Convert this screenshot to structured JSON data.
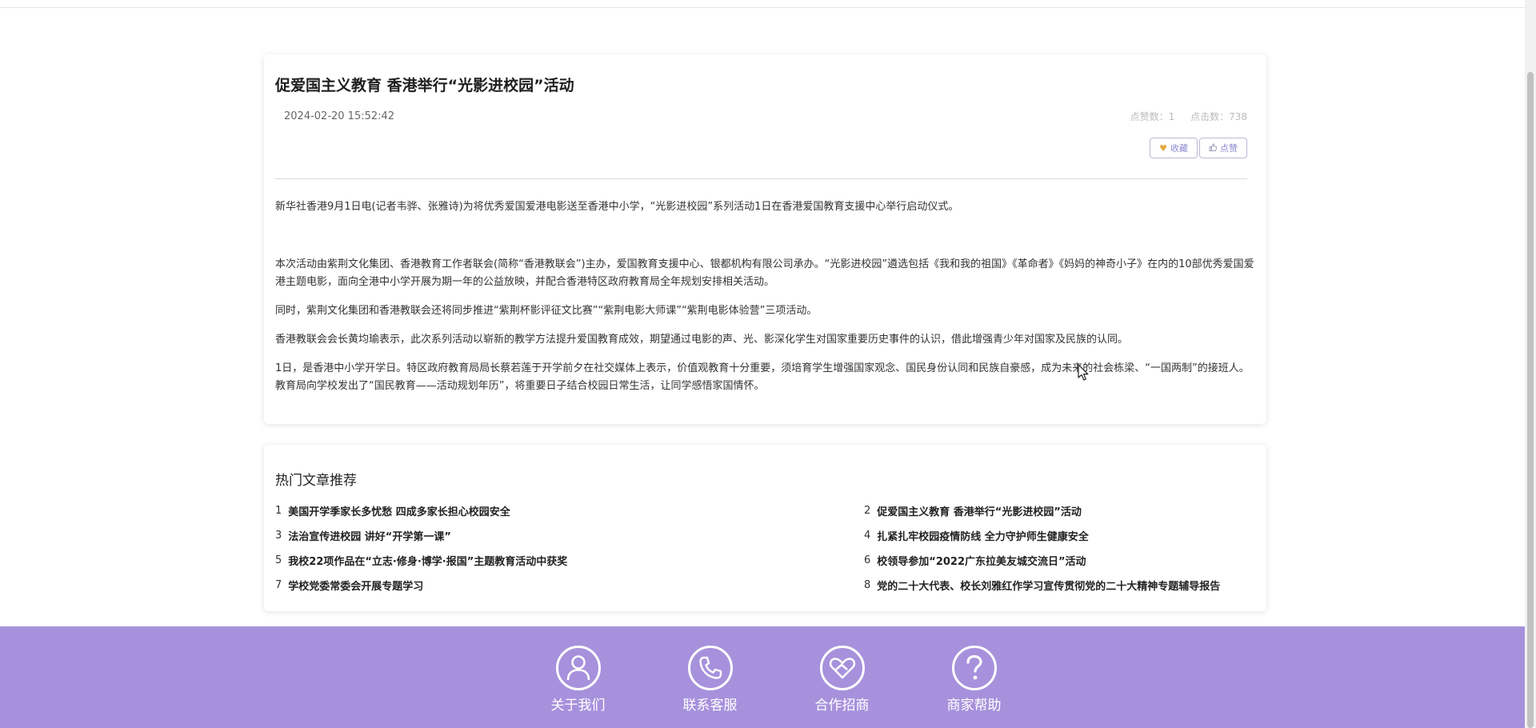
{
  "article": {
    "title": "促爱国主义教育 香港举行“光影进校园”活动",
    "date": "2024-02-20 15:52:42",
    "likes_text": "点赞数：1",
    "clicks_text": "点击数：738",
    "favorite_label": "收藏",
    "like_label": "点赞",
    "paragraphs": [
      "新华社香港9月1日电(记者韦骅、张雅诗)为将优秀爱国爱港电影送至香港中小学，“光影进校园”系列活动1日在香港爱国教育支援中心举行启动仪式。",
      "本次活动由紫荆文化集团、香港教育工作者联会(简称“香港教联会”)主办，爱国教育支援中心、银都机构有限公司承办。“光影进校园”遴选包括《我和我的祖国》《革命者》《妈妈的神奇小子》在内的10部优秀爱国爱港主题电影，面向全港中小学开展为期一年的公益放映，并配合香港特区政府教育局全年规划安排相关活动。",
      "同时，紫荆文化集团和香港教联会还将同步推进“紫荆杯影评征文比赛”“紫荆电影大师课”“紫荆电影体验营”三项活动。",
      "香港教联会会长黄均瑜表示，此次系列活动以崭新的教学方法提升爱国教育成效，期望通过电影的声、光、影深化学生对国家重要历史事件的认识，借此增强青少年对国家及民族的认同。",
      "1日，是香港中小学开学日。特区政府教育局局长蔡若莲于开学前夕在社交媒体上表示，价值观教育十分重要，须培育学生增强国家观念、国民身份认同和民族自豪感，成为未来的社会栋梁、“一国两制”的接班人。教育局向学校发出了“国民教育——活动规划年历”，将重要日子结合校园日常生活，让同学感悟家国情怀。"
    ]
  },
  "hot": {
    "title": "热门文章推荐",
    "items": [
      {
        "num": "1",
        "text": "美国开学季家长多忧愁 四成多家长担心校园安全"
      },
      {
        "num": "2",
        "text": "促爱国主义教育 香港举行“光影进校园”活动"
      },
      {
        "num": "3",
        "text": "法治宣传进校园 讲好“开学第一课”"
      },
      {
        "num": "4",
        "text": "扎紧扎牢校园疫情防线 全力守护师生健康安全"
      },
      {
        "num": "5",
        "text": "我校22项作品在“立志·修身·博学·报国”主题教育活动中获奖"
      },
      {
        "num": "6",
        "text": "校领导参加“2022广东拉美友城交流日”活动"
      },
      {
        "num": "7",
        "text": "学校党委常委会开展专题学习"
      },
      {
        "num": "8",
        "text": "党的二十大代表、校长刘雅红作学习宣传贯彻党的二十大精神专题辅导报告"
      }
    ]
  },
  "footer": {
    "items": [
      {
        "label": "关于我们",
        "icon": "user-icon"
      },
      {
        "label": "联系客服",
        "icon": "phone-icon"
      },
      {
        "label": "合作招商",
        "icon": "handshake-heart-icon"
      },
      {
        "label": "商家帮助",
        "icon": "question-icon"
      }
    ]
  },
  "colors": {
    "footer_bg": "#a791dc",
    "button_text": "#8a8ad0"
  }
}
